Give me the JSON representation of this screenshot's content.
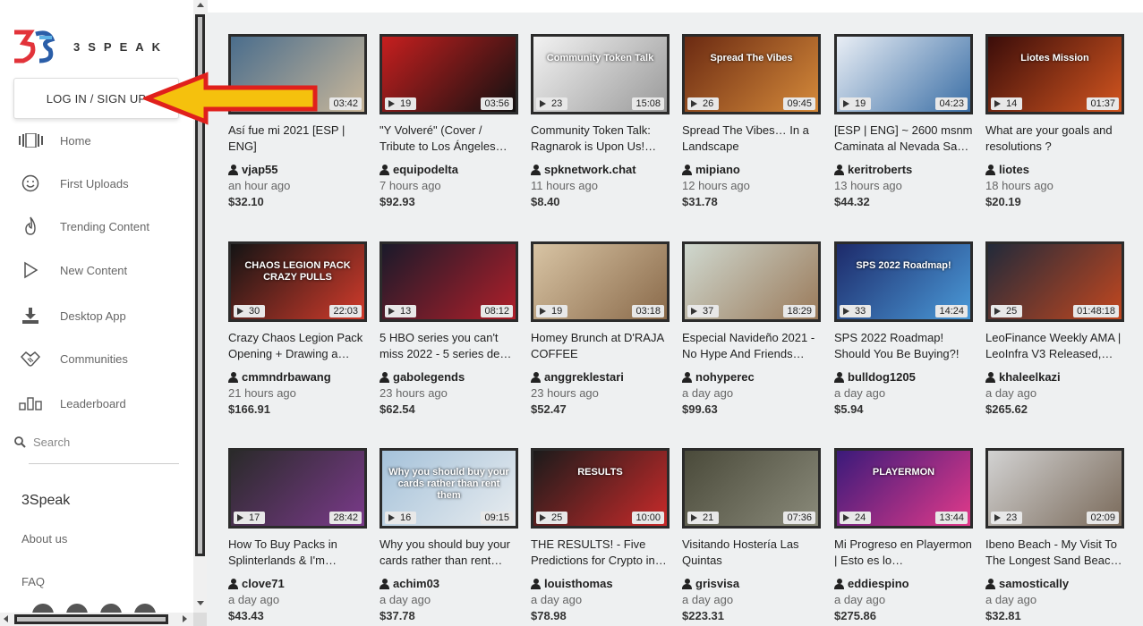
{
  "sidebar": {
    "logo_text": "3SPEAK",
    "login_label": "LOG IN / SIGN UP",
    "nav": [
      {
        "label": "Home",
        "icon": "home-icon"
      },
      {
        "label": "First Uploads",
        "icon": "smiley-icon"
      },
      {
        "label": "Trending Content",
        "icon": "flame-icon"
      },
      {
        "label": "New Content",
        "icon": "play-icon"
      },
      {
        "label": "Desktop App",
        "icon": "download-icon"
      },
      {
        "label": "Communities",
        "icon": "handshake-icon"
      },
      {
        "label": "Leaderboard",
        "icon": "leaderboard-icon"
      }
    ],
    "search_label": "Search",
    "section_heading": "3Speak",
    "about_label": "About us",
    "faq_label": "FAQ"
  },
  "videos": [
    {
      "views": "",
      "duration": "03:42",
      "title": "Así fue mi 2021 [ESP | ENG]",
      "author": "vjap55",
      "time": "an hour ago",
      "price": "$32.10",
      "colors": [
        "#4a6d8c",
        "#c9b79a"
      ]
    },
    {
      "views": "19",
      "duration": "03:56",
      "title": "\"Y Volveré\" (Cover / Tribute to Los Ángeles…",
      "author": "equipodelta",
      "time": "7 hours ago",
      "price": "$92.93",
      "colors": [
        "#c61f1f",
        "#111111"
      ]
    },
    {
      "views": "23",
      "duration": "15:08",
      "title": "Community Token Talk: Ragnarok is Upon Us!…",
      "author": "spknetwork.chat",
      "time": "11 hours ago",
      "price": "$8.40",
      "colors": [
        "#f2f2f2",
        "#9a9a9a"
      ]
    },
    {
      "views": "26",
      "duration": "09:45",
      "title": "Spread The Vibes… In a Landscape",
      "author": "mipiano",
      "time": "12 hours ago",
      "price": "$31.78",
      "colors": [
        "#6b2a12",
        "#d58a3a"
      ]
    },
    {
      "views": "19",
      "duration": "04:23",
      "title": "[ESP | ENG] ~ 2600 msnm Caminata al Nevada Sa…",
      "author": "keritroberts",
      "time": "13 hours ago",
      "price": "$44.32",
      "colors": [
        "#e9eef5",
        "#3a6ea5"
      ]
    },
    {
      "views": "14",
      "duration": "01:37",
      "title": "What are your goals and resolutions ?",
      "author": "liotes",
      "time": "18 hours ago",
      "price": "$20.19",
      "colors": [
        "#3b0d0a",
        "#d2551f"
      ]
    },
    {
      "views": "30",
      "duration": "22:03",
      "title": "Crazy Chaos Legion Pack Opening + Drawing a…",
      "author": "cmmndrbawang",
      "time": "21 hours ago",
      "price": "$166.91",
      "colors": [
        "#141414",
        "#d23b2b"
      ]
    },
    {
      "views": "13",
      "duration": "08:12",
      "title": "5 HBO series you can't miss 2022 - 5 series de…",
      "author": "gabolegends",
      "time": "23 hours ago",
      "price": "$62.54",
      "colors": [
        "#1a1a2a",
        "#b01f2a"
      ]
    },
    {
      "views": "19",
      "duration": "03:18",
      "title": "Homey Brunch at D'RAJA COFFEE",
      "author": "anggreklestari",
      "time": "23 hours ago",
      "price": "$52.47",
      "colors": [
        "#d8c4a4",
        "#8a6a4a"
      ]
    },
    {
      "views": "37",
      "duration": "18:29",
      "title": "Especial Navideño 2021 - No Hype And Friends…",
      "author": "nohyperec",
      "time": "a day ago",
      "price": "$99.63",
      "colors": [
        "#cfd8cf",
        "#9a7a5a"
      ]
    },
    {
      "views": "33",
      "duration": "14:24",
      "title": "SPS 2022 Roadmap! Should You Be Buying?!",
      "author": "bulldog1205",
      "time": "a day ago",
      "price": "$5.94",
      "colors": [
        "#1d2a6a",
        "#4a9ad8"
      ]
    },
    {
      "views": "25",
      "duration": "01:48:18",
      "title": "LeoFinance Weekly AMA | LeoInfra V3 Released,…",
      "author": "khaleelkazi",
      "time": "a day ago",
      "price": "$265.62",
      "colors": [
        "#222a3a",
        "#c2471f"
      ]
    },
    {
      "views": "17",
      "duration": "28:42",
      "title": "How To Buy Packs in Splinterlands & I'm…",
      "author": "clove71",
      "time": "a day ago",
      "price": "$43.43",
      "colors": [
        "#2a2a2a",
        "#7a3a8a"
      ]
    },
    {
      "views": "16",
      "duration": "09:15",
      "title": "Why you should buy your cards rather than rent…",
      "author": "achim03",
      "time": "a day ago",
      "price": "$37.78",
      "colors": [
        "#a5c2da",
        "#e8ecef"
      ]
    },
    {
      "views": "25",
      "duration": "10:00",
      "title": "THE RESULTS! - Five Predictions for Crypto in…",
      "author": "louisthomas",
      "time": "a day ago",
      "price": "$78.98",
      "colors": [
        "#1b1b1b",
        "#c92a2a"
      ]
    },
    {
      "views": "21",
      "duration": "07:36",
      "title": "Visitando Hostería Las Quintas",
      "author": "grisvisa",
      "time": "a day ago",
      "price": "$223.31",
      "colors": [
        "#4a4a3a",
        "#8a8a7a"
      ]
    },
    {
      "views": "24",
      "duration": "13:44",
      "title": "Mi Progreso en Playermon | Esto es lo…",
      "author": "eddiespino",
      "time": "a day ago",
      "price": "$275.86",
      "colors": [
        "#3a1a7a",
        "#e23a8a"
      ]
    },
    {
      "views": "23",
      "duration": "02:09",
      "title": "Ibeno Beach - My Visit To The Longest Sand Beac…",
      "author": "samostically",
      "time": "a day ago",
      "price": "$32.81",
      "colors": [
        "#d2d2d2",
        "#7a6a5a"
      ]
    }
  ],
  "thumb_captions": {
    "t0": "",
    "t2": "Community Token Talk",
    "t3": "Spread The Vibes",
    "t5": "Liotes Mission",
    "t6": "CHAOS LEGION PACK CRAZY PULLS",
    "t10": "SPS 2022 Roadmap!",
    "t13": "Why you should buy your cards rather than rent them",
    "t14": "RESULTS",
    "t16": "PLAYERMON"
  }
}
